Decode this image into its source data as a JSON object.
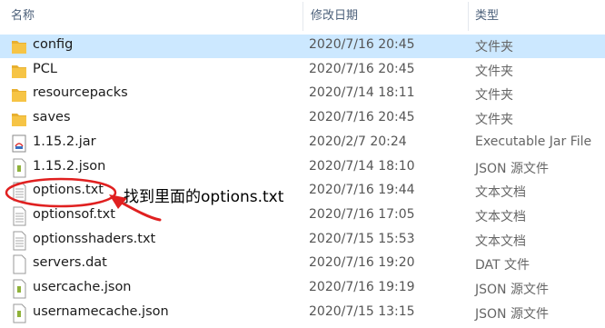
{
  "columns": {
    "name": "名称",
    "date": "修改日期",
    "type": "类型"
  },
  "colors": {
    "selected_row": "#cce8ff",
    "folder": "#f6c445",
    "annotation": "#e02020"
  },
  "rows": [
    {
      "name": "config",
      "date": "2020/7/16 20:45",
      "type": "文件夹",
      "icon": "folder-icon",
      "selected": true
    },
    {
      "name": "PCL",
      "date": "2020/7/16 20:45",
      "type": "文件夹",
      "icon": "folder-icon"
    },
    {
      "name": "resourcepacks",
      "date": "2020/7/14 18:11",
      "type": "文件夹",
      "icon": "folder-icon"
    },
    {
      "name": "saves",
      "date": "2020/7/16 20:45",
      "type": "文件夹",
      "icon": "folder-icon"
    },
    {
      "name": "1.15.2.jar",
      "date": "2020/2/7 20:24",
      "type": "Executable Jar File",
      "icon": "jar-icon"
    },
    {
      "name": "1.15.2.json",
      "date": "2020/7/14 18:10",
      "type": "JSON 源文件",
      "icon": "json-file-icon"
    },
    {
      "name": "options.txt",
      "date": "2020/7/16 19:44",
      "type": "文本文档",
      "icon": "text-file-icon"
    },
    {
      "name": "optionsof.txt",
      "date": "2020/7/16 17:05",
      "type": "文本文档",
      "icon": "text-file-icon"
    },
    {
      "name": "optionsshaders.txt",
      "date": "2020/7/15 15:53",
      "type": "文本文档",
      "icon": "text-file-icon"
    },
    {
      "name": "servers.dat",
      "date": "2020/7/16 19:20",
      "type": "DAT 文件",
      "icon": "blank-file-icon"
    },
    {
      "name": "usercache.json",
      "date": "2020/7/16 19:19",
      "type": "JSON 源文件",
      "icon": "json-file-icon"
    },
    {
      "name": "usernamecache.json",
      "date": "2020/7/15 13:15",
      "type": "JSON 源文件",
      "icon": "json-file-icon"
    }
  ],
  "annotation": {
    "text": "找到里面的options.txt"
  }
}
